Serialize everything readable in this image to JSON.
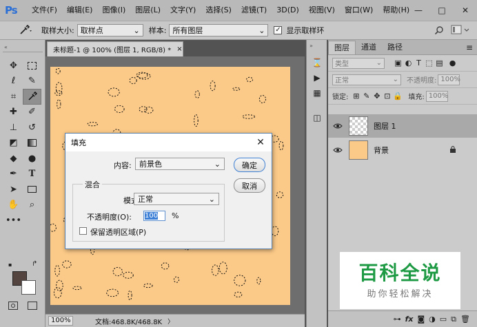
{
  "app": {
    "logo": "Ps"
  },
  "menu": [
    "文件(F)",
    "编辑(E)",
    "图像(I)",
    "图层(L)",
    "文字(Y)",
    "选择(S)",
    "滤镜(T)",
    "3D(D)",
    "视图(V)",
    "窗口(W)",
    "帮助(H)"
  ],
  "window_controls": {
    "minimize": "—",
    "maximize": "□",
    "close": "✕"
  },
  "options": {
    "sample_size_label": "取样大小:",
    "sample_size_value": "取样点",
    "sample_label": "样本:",
    "sample_value": "所有图层",
    "show_ring_label": "显示取样环",
    "show_ring_checked": true
  },
  "document": {
    "tab_title": "未标题-1 @ 100% (图层 1, RGB/8) *",
    "tab_close": "×",
    "zoom": "100%",
    "doc_info": "文档:468.8K/468.8K"
  },
  "layers_panel": {
    "tabs": [
      "图层",
      "通道",
      "路径"
    ],
    "filter_placeholder": "类型",
    "blend_mode": "正常",
    "opacity_label": "不透明度:",
    "opacity_value": "100%",
    "lock_label": "锁定:",
    "fill_label": "填充:",
    "fill_value": "100%",
    "layers": [
      {
        "name": "图层 1",
        "selected": true,
        "thumb": "transparent"
      },
      {
        "name": "背景",
        "selected": false,
        "thumb": "#fcca88"
      }
    ],
    "bottom_icons": [
      "link-icon",
      "fx-icon",
      "mask-icon",
      "adjustment-icon",
      "group-icon",
      "new-layer-icon",
      "trash-icon"
    ],
    "fx_label": "fx"
  },
  "fill_dialog": {
    "title": "填充",
    "close": "✕",
    "content_label": "内容:",
    "content_value": "前景色",
    "ok_label": "确定",
    "cancel_label": "取消",
    "blend_group_label": "混合",
    "mode_label": "模式:",
    "mode_value": "正常",
    "opacity_label": "不透明度(O):",
    "opacity_value": "100",
    "opacity_unit": "%",
    "preserve_label": "保留透明区域(P)",
    "preserve_checked": false
  },
  "colors": {
    "foreground": "#54443f",
    "background": "#ffffff",
    "canvas": "#fcca88"
  },
  "watermark": {
    "title": "百科全说",
    "subtitle": "助你轻松解决"
  }
}
